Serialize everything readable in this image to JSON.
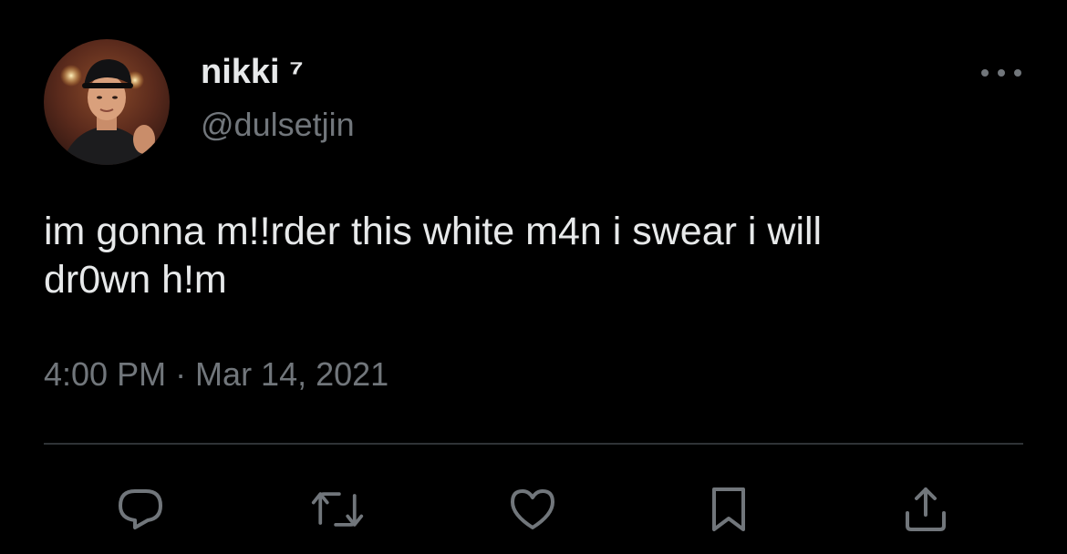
{
  "author": {
    "display_name": "nikki ⁷",
    "handle": "@dulsetjin",
    "avatar_icon": "profile-photo"
  },
  "tweet": {
    "text": "im gonna m!!rder this white m4n i swear i will\ndr0wn h!m",
    "timestamp": "4:00 PM · Mar 14, 2021"
  },
  "icons": {
    "more": "more-horizontal-icon",
    "reply": "reply-icon",
    "retweet": "retweet-icon",
    "like": "heart-icon",
    "bookmark": "bookmark-icon",
    "share": "share-icon"
  },
  "colors": {
    "background": "#000000",
    "primary_text": "#e7e9ea",
    "secondary_text": "#71767b",
    "divider": "#2f3336"
  }
}
